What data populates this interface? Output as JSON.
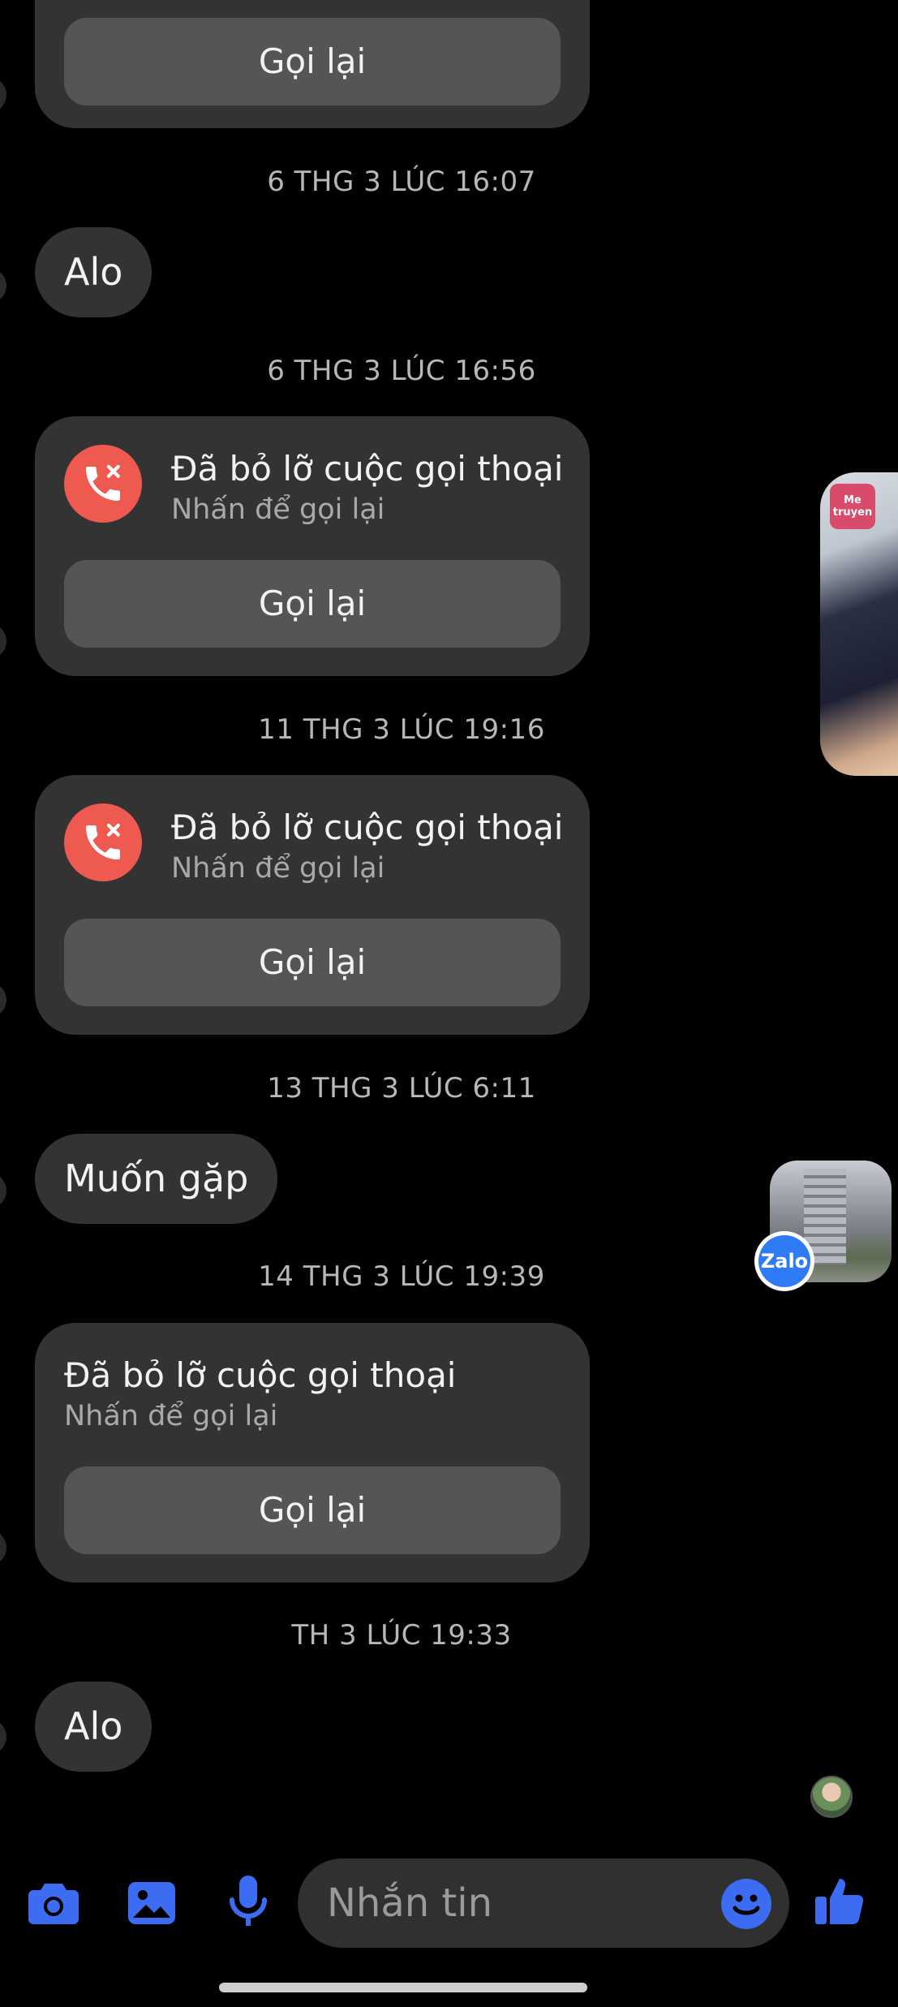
{
  "colors": {
    "background": "#000000",
    "bubble": "#333333",
    "button": "#555555",
    "missed_call_red": "#ee5a4f",
    "accent_blue": "#3b6cf2",
    "timestamp_text": "#b7b7b7"
  },
  "thread": {
    "top_card": {
      "button_label": "Gọi lại"
    },
    "ts1": "6 THG 3 LÚC 16:07",
    "msg1": "Alo",
    "ts2": "6 THG 3 LÚC 16:56",
    "call1": {
      "title": "Đã bỏ lỡ cuộc gọi thoại",
      "subtitle": "Nhấn để gọi lại",
      "button_label": "Gọi lại"
    },
    "ts3": "11 THG 3 LÚC 19:16",
    "call2": {
      "title": "Đã bỏ lỡ cuộc gọi thoại",
      "subtitle": "Nhấn để gọi lại",
      "button_label": "Gọi lại"
    },
    "ts4": "13 THG 3 LÚC 6:11",
    "msg2": "Muốn gặp",
    "ts5": "14 THG 3 LÚC 19:39",
    "call3": {
      "title": "Đã bỏ lỡ cuộc gọi thoại",
      "subtitle": "Nhấn để gọi lại",
      "button_label": "Gọi lại"
    },
    "ts6": "TH 3 LÚC 19:33",
    "msg3": "Alo"
  },
  "floating": {
    "zalo_badge": "Zalo",
    "metruyen_logo": "Me truyen"
  },
  "composer": {
    "placeholder": "Nhắn tin",
    "icons": [
      "camera-icon",
      "gallery-icon",
      "microphone-icon",
      "emoji-icon",
      "like-icon"
    ]
  }
}
